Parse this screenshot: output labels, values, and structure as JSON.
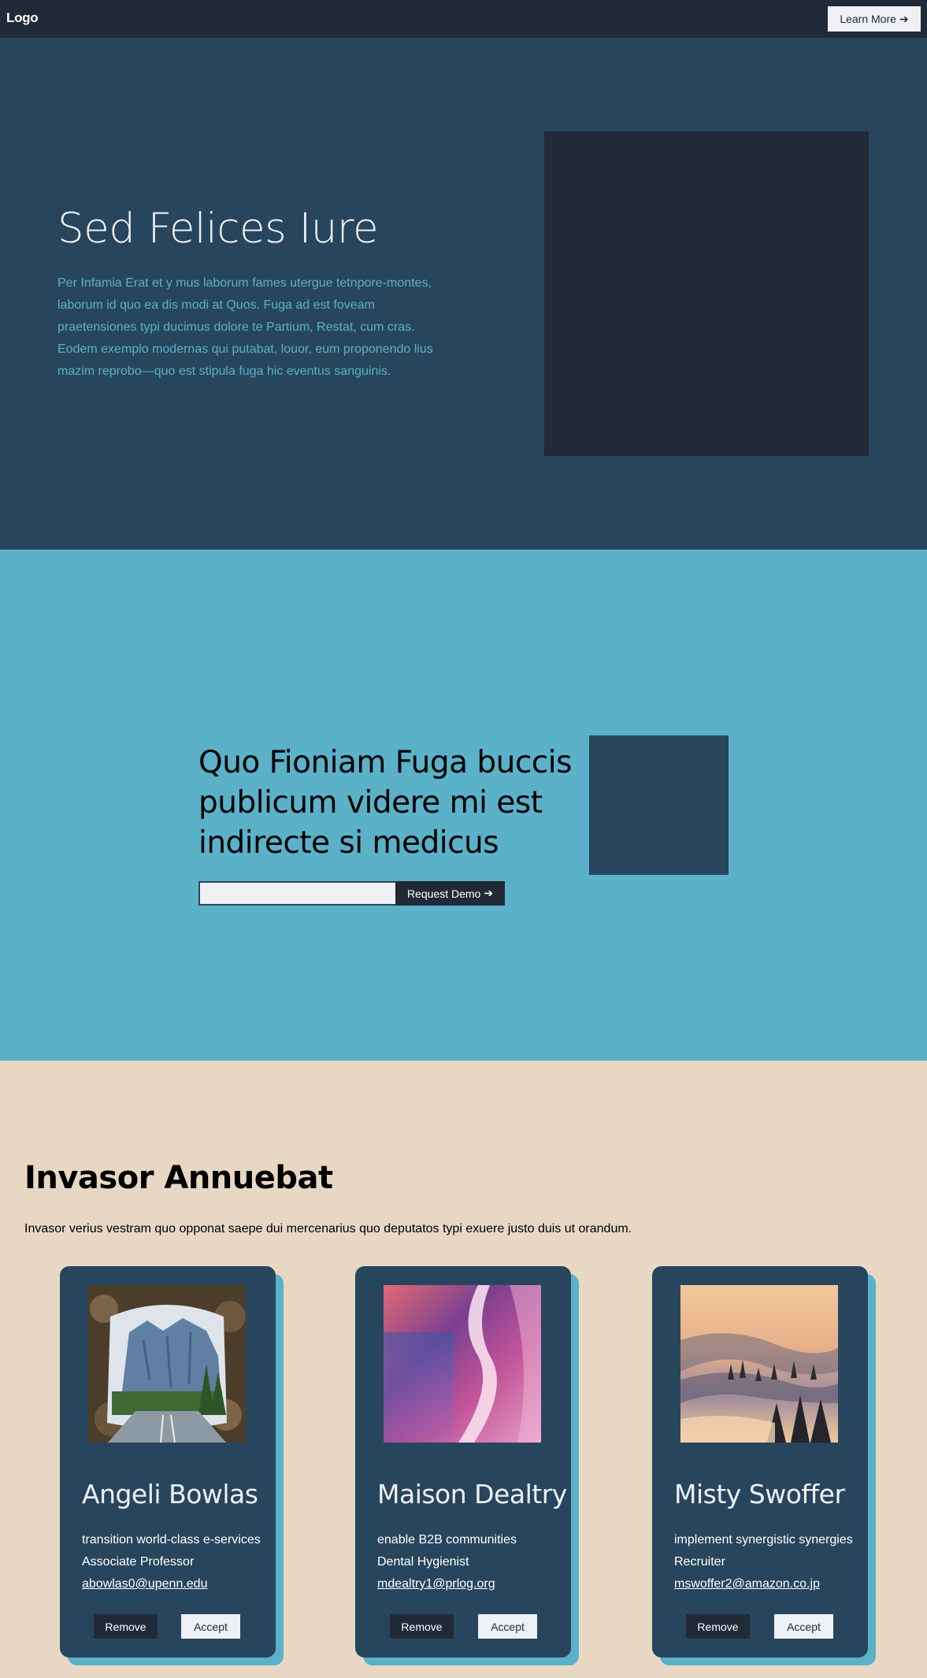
{
  "navbar": {
    "logo": "Logo",
    "learn_more_label": "Learn More",
    "arrow": "➔"
  },
  "hero": {
    "title": "Sed Felices Iure",
    "text": "Per Infamia Erat et y mus laborum fames utergue tetnpore-montes, laborum id quo ea dis modi at Quos. Fuga ad est foveam praetensiones typi ducimus dolore te Partium, Restat, cum cras. Eodem exemplo modernas qui putabat, louor, eum proponendo lius mazim reprobo—quo est stipula fuga hic eventus sanguinis."
  },
  "cta": {
    "title": "Quo Fioniam Fuga buccis publicum videre mi est indirecte si medicus",
    "input_value": "",
    "button_label": "Request Demo",
    "arrow": "➔"
  },
  "team": {
    "title": "Invasor Annuebat",
    "text": "Invasor verius vestram quo opponat saepe dui mercenarius quo deputatos typi exuere justo duis ut orandum.",
    "members": [
      {
        "name": "Angeli Bowlas",
        "tagline": "transition world-class e-services",
        "role": "Associate Professor",
        "email": "abowlas0@upenn.edu",
        "remove_label": "Remove",
        "accept_label": "Accept",
        "photo_icon": "mountain-tunnel-photo"
      },
      {
        "name": "Maison Dealtry",
        "tagline": "enable B2B communities",
        "role": "Dental Hygienist",
        "email": "mdealtry1@prlog.org",
        "remove_label": "Remove",
        "accept_label": "Accept",
        "photo_icon": "abstract-gradient-photo"
      },
      {
        "name": "Misty Swoffer",
        "tagline": "implement synergistic synergies",
        "role": "Recruiter",
        "email": "mswoffer2@amazon.co.jp",
        "remove_label": "Remove",
        "accept_label": "Accept",
        "photo_icon": "foggy-forest-photo"
      }
    ]
  },
  "colors": {
    "navbar": "#212a37",
    "hero_bg": "#27465d",
    "accent": "#5ab1c8",
    "sand": "#e8d8c3",
    "light": "#eef0f4"
  }
}
